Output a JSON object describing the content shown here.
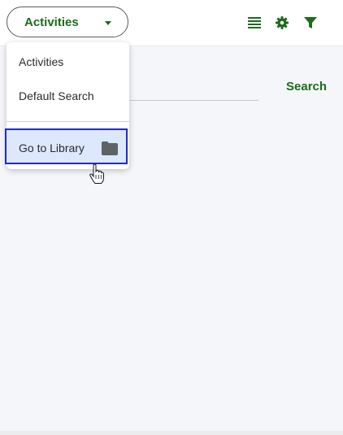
{
  "header": {
    "view_selector": {
      "label": "Activities"
    },
    "icons": [
      "list-icon",
      "gear-icon",
      "filter-icon"
    ]
  },
  "search": {
    "button_label": "Search"
  },
  "dropdown": {
    "items": [
      {
        "label": "Activities"
      },
      {
        "label": "Default Search"
      }
    ],
    "library_item": {
      "label": "Go to Library",
      "icon": "folder-icon"
    }
  },
  "colors": {
    "accent_green": "#1d6b1d",
    "highlight_border": "#1f2acb",
    "highlight_fill": "#dde8fc"
  }
}
